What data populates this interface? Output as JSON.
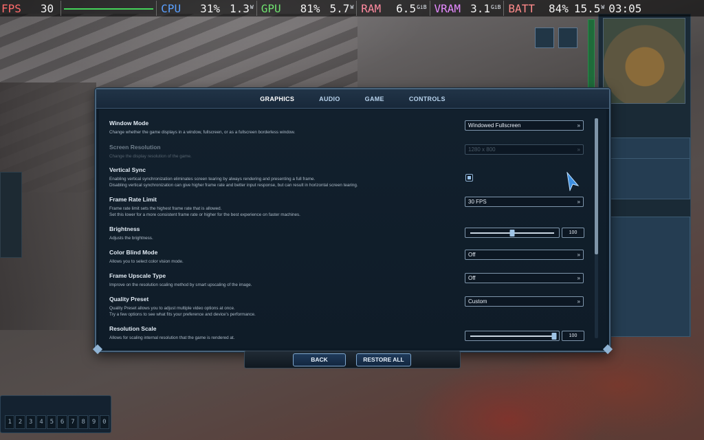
{
  "perf_overlay": {
    "fps": {
      "label": "FPS",
      "value": "30",
      "color": "#ff6b6b"
    },
    "cpu": {
      "label": "CPU",
      "value": "31%",
      "power": "1.3",
      "power_unit": "W",
      "color": "#5aa0ff"
    },
    "gpu": {
      "label": "GPU",
      "value": "81%",
      "power": "5.7",
      "power_unit": "W",
      "color": "#6fe06f"
    },
    "ram": {
      "label": "RAM",
      "value": "6.5",
      "unit": "GiB",
      "color": "#ff8aa0"
    },
    "vram": {
      "label": "VRAM",
      "value": "3.1",
      "unit": "GiB",
      "color": "#e58aff"
    },
    "batt": {
      "label": "BATT",
      "value": "84%",
      "power": "15.5",
      "power_unit": "W",
      "color": "#ff8a8a"
    },
    "clock": "03:05"
  },
  "tabs": [
    {
      "label": "GRAPHICS",
      "active": true
    },
    {
      "label": "AUDIO",
      "active": false
    },
    {
      "label": "GAME",
      "active": false
    },
    {
      "label": "CONTROLS",
      "active": false
    }
  ],
  "settings": {
    "window_mode": {
      "name": "Window Mode",
      "desc": "Change whether the game displays in a window, fullscreen, or as a fullscreen borderless window.",
      "value": "Windowed Fullscreen"
    },
    "screen_resolution": {
      "name": "Screen Resolution",
      "desc": "Change the display resolution of the game.",
      "value": "1280 x 800",
      "enabled": false
    },
    "vertical_sync": {
      "name": "Vertical Sync",
      "desc1": "Enabling vertical synchronization eliminates screen tearing by always rendering and presenting a full frame.",
      "desc2": "Disabling vertical synchronization can give higher frame rate and better input response, but can result in horizontal screen tearing.",
      "checked": true
    },
    "frame_rate_limit": {
      "name": "Frame Rate Limit",
      "desc1": "Frame rate limit sets the highest frame rate that is allowed.",
      "desc2": "Set this lower for a more consistent frame rate or higher for the best experience on faster machines.",
      "value": "30 FPS"
    },
    "brightness": {
      "name": "Brightness",
      "desc": "Adjusts the brightness.",
      "value": "100",
      "level": 0.5
    },
    "color_blind_mode": {
      "name": "Color Blind Mode",
      "desc": "Allows you to select color vision mode.",
      "value": "Off"
    },
    "frame_upscale_type": {
      "name": "Frame Upscale Type",
      "desc": "Improve on the resolution scaling method by smart upscaling of the image.",
      "value": "Off"
    },
    "quality_preset": {
      "name": "Quality Preset",
      "desc1": "Quality Preset allows you to adjust multiple video options at once.",
      "desc2": "Try a few options to see what fits your preference and device's performance.",
      "value": "Custom"
    },
    "resolution_scale": {
      "name": "Resolution Scale",
      "desc": "Allows for scaling internal resolution that the game is rendered at.",
      "value": "100",
      "level": 1.0
    }
  },
  "buttons": {
    "back": "BACK",
    "restore_all": "RESTORE ALL"
  },
  "hotbar_numbers": [
    "1",
    "2",
    "3",
    "4",
    "5",
    "6",
    "7",
    "8",
    "9",
    "0"
  ],
  "colors": {
    "dialog_bg": "#0d1a26",
    "accent": "#7fa8d0",
    "text": "#e8eef6"
  }
}
